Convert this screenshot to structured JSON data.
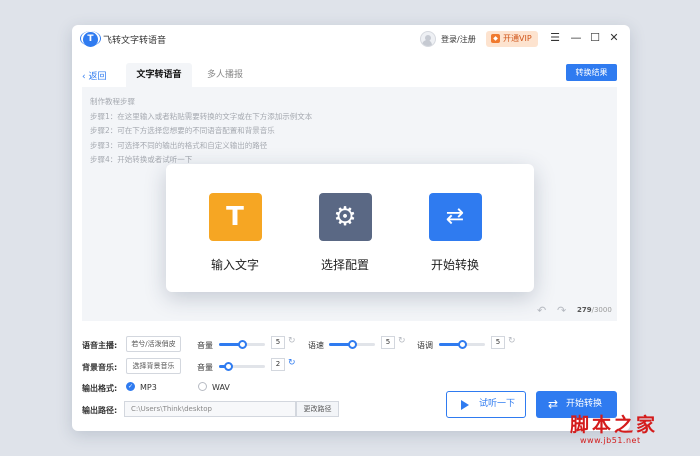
{
  "app": {
    "title": "飞转文字转语音",
    "logo_letter": "T"
  },
  "header": {
    "login_label": "登录/注册",
    "vip_label": "开通VIP",
    "vip_icon": "diamond-icon"
  },
  "window_controls": {
    "menu": "☰",
    "minimize": "—",
    "maximize": "☐",
    "close": "✕"
  },
  "nav": {
    "back_label": "返回",
    "tabs": [
      {
        "label": "文字转语音",
        "active": true
      },
      {
        "label": "多人播报",
        "active": false
      }
    ],
    "result_button": "转换结果"
  },
  "editor": {
    "lines": [
      "制作教程步骤",
      "步骤1：在这里输入或者粘贴需要转换的文字或在下方添加示例文本",
      "步骤2：可在下方选择您想要的不同语音配置和背景音乐",
      "步骤3：可选择不同的输出的格式和自定义输出的路径",
      "步骤4：开始转换或者试听一下"
    ],
    "char_count": "279",
    "char_limit": "/3000"
  },
  "overlay": {
    "items": [
      {
        "label": "输入文字",
        "icon": "text-t-icon",
        "glyph": "T"
      },
      {
        "label": "选择配置",
        "icon": "gear-icon",
        "glyph": "⚙"
      },
      {
        "label": "开始转换",
        "icon": "convert-icon",
        "glyph": "⇄"
      }
    ]
  },
  "settings": {
    "anchor_label": "语音主播:",
    "anchor_value": "若兮/活泼俏皮",
    "bgm_label": "背景音乐:",
    "bgm_button": "选择背景音乐",
    "volume_label": "音量",
    "volume_value": "5",
    "volume_level": 0.5,
    "speed_label": "语速",
    "speed_value": "5",
    "speed_level": 0.5,
    "pitch_label": "语调",
    "pitch_value": "5",
    "pitch_level": 0.5,
    "bgm_volume_label": "音量",
    "bgm_volume_value": "2",
    "bgm_volume_level": 0.2,
    "format_label": "输出格式:",
    "formats": [
      {
        "label": "MP3",
        "checked": true
      },
      {
        "label": "WAV",
        "checked": false
      }
    ],
    "path_label": "输出路径:",
    "path_value": "C:\\Users\\Think\\desktop",
    "change_path": "更改路径"
  },
  "actions": {
    "listen_label": "试听一下",
    "start_label": "开始转换"
  },
  "watermark": {
    "text": "脚本之家",
    "url": "www.jb51.net"
  },
  "colors": {
    "accent": "#2f7bf0",
    "orange": "#f6a623",
    "slate": "#5a6884",
    "vip": "#fde3cf"
  }
}
